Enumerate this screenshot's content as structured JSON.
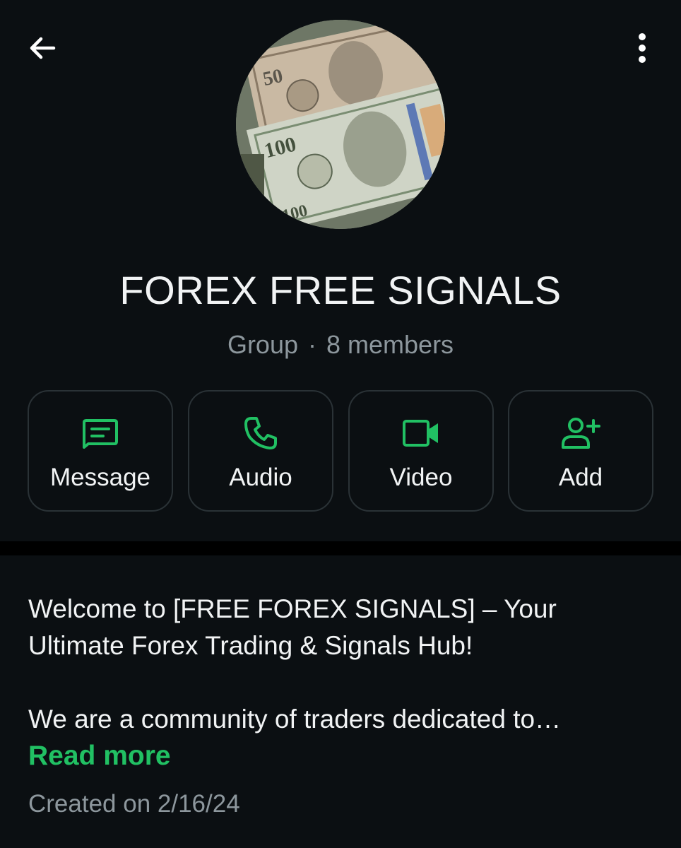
{
  "header": {
    "back_icon": "arrow-left-icon",
    "menu_icon": "more-vertical-icon"
  },
  "group": {
    "name": "FOREX FREE SIGNALS",
    "type": "Group",
    "separator": "·",
    "members": "8 members"
  },
  "actions": [
    {
      "label": "Message",
      "icon": "message-icon"
    },
    {
      "label": "Audio",
      "icon": "phone-icon"
    },
    {
      "label": "Video",
      "icon": "video-camera-icon"
    },
    {
      "label": "Add",
      "icon": "add-person-icon"
    }
  ],
  "description": {
    "line1": "Welcome to [FREE FOREX SIGNALS] – Your Ultimate Forex Trading & Signals Hub!",
    "line2": "We are a community of traders dedicated to…",
    "read_more": "Read more"
  },
  "created": "Created on 2/16/24",
  "colors": {
    "background": "#0b0f12",
    "accent": "#21c063",
    "muted_text": "#8d979d",
    "border": "#2a3236"
  }
}
